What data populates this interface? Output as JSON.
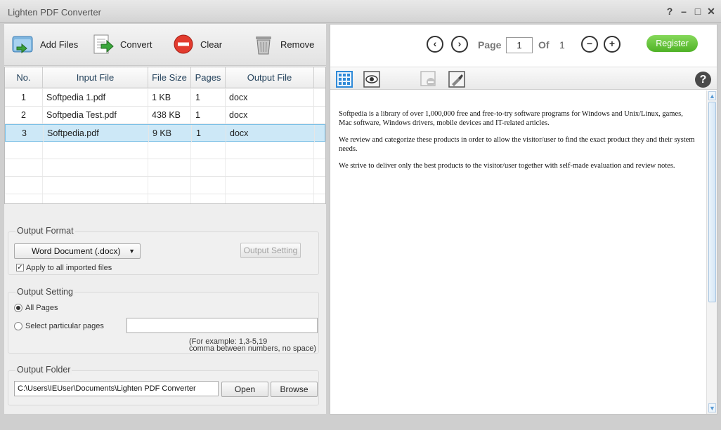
{
  "window": {
    "title": "Lighten PDF Converter",
    "controls": {
      "help": "?",
      "minimize": "–",
      "maximize": "□",
      "close": "✕"
    }
  },
  "toolbar": {
    "add_files": "Add Files",
    "convert": "Convert",
    "clear": "Clear",
    "remove": "Remove"
  },
  "table": {
    "headers": [
      "No.",
      "Input File",
      "File Size",
      "Pages",
      "Output File"
    ],
    "rows": [
      {
        "no": "1",
        "input": "Softpedia 1.pdf",
        "size": "1 KB",
        "pages": "1",
        "output": "docx"
      },
      {
        "no": "2",
        "input": "Softpedia Test.pdf",
        "size": "438 KB",
        "pages": "1",
        "output": "docx"
      },
      {
        "no": "3",
        "input": "Softpedia.pdf",
        "size": "9 KB",
        "pages": "1",
        "output": "docx"
      }
    ],
    "selected_row": 3
  },
  "output_format": {
    "label": "Output Format",
    "selected": "Word Document (.docx)",
    "setting_button": "Output Setting",
    "apply_all_label": "Apply to all imported files",
    "apply_all_checked": true
  },
  "output_setting": {
    "label": "Output Setting",
    "all_pages": "All Pages",
    "particular_pages": "Select particular pages",
    "pages_value": "",
    "hint_line1": "(For example: 1,3-5,19",
    "hint_line2": "comma between numbers, no space)"
  },
  "output_folder": {
    "label": "Output Folder",
    "path": "C:\\Users\\IEUser\\Documents\\Lighten PDF Converter",
    "open": "Open",
    "browse": "Browse"
  },
  "viewer": {
    "page_label": "Page",
    "current_page": "1",
    "of_label": "Of",
    "total_pages": "1",
    "register": "Register",
    "help": "?",
    "paragraphs": [
      "Softpedia is a library of over 1,000,000 free and free-to-try software programs for Windows and Unix/Linux, games, Mac software, Windows drivers, mobile devices and IT-related articles.",
      "We review and categorize these products in order to allow the visitor/user to find the exact product they and their system needs.",
      "We strive to deliver only the best products to the visitor/user together with self-made evaluation and review notes."
    ]
  },
  "colors": {
    "accent_green": "#4fb226",
    "selection": "#cde8f7",
    "icon_blue": "#2f8ad8"
  }
}
